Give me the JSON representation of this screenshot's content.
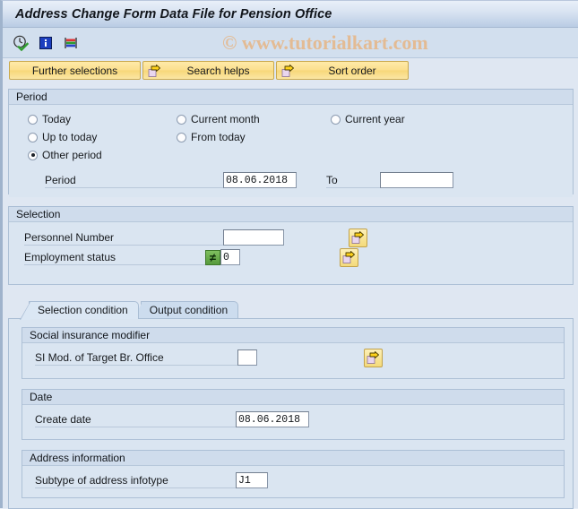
{
  "window": {
    "title": "Address Change Form Data File for Pension Office"
  },
  "toolbar": {
    "icons": [
      {
        "name": "execute-clock-icon",
        "glyph": "clock-check"
      },
      {
        "name": "info-icon",
        "glyph": "info"
      },
      {
        "name": "variant-icon",
        "glyph": "variant"
      }
    ],
    "watermark": "© www.tutorialkart.com"
  },
  "action_buttons": [
    {
      "label": "Further selections",
      "icon": null
    },
    {
      "label": "Search helps",
      "icon": "arrow-right-icon"
    },
    {
      "label": "Sort order",
      "icon": "arrow-right-icon"
    }
  ],
  "period_section": {
    "title": "Period",
    "radios": [
      {
        "label": "Today",
        "checked": false
      },
      {
        "label": "Current month",
        "checked": false
      },
      {
        "label": "Current year",
        "checked": false
      },
      {
        "label": "Up to today",
        "checked": false
      },
      {
        "label": "From today",
        "checked": false
      },
      {
        "label": "Other period",
        "checked": true
      }
    ],
    "period_label": "Period",
    "period_value": "08.06.2018",
    "to_label": "To",
    "to_value": "",
    "to_placeholder": ""
  },
  "selection_section": {
    "title": "Selection",
    "personnel_number_label": "Personnel Number",
    "personnel_number_value": "",
    "employment_status_label": "Employment status",
    "employment_status_operator": "≠",
    "employment_status_value": "0",
    "multi_select_tooltip": "Multiple selection"
  },
  "tabs": [
    {
      "label": "Selection condition",
      "active": true
    },
    {
      "label": "Output condition",
      "active": false
    }
  ],
  "si_section": {
    "title": "Social insurance modifier",
    "si_mod_label": "SI Mod. of Target Br. Office",
    "si_mod_value": ""
  },
  "date_section": {
    "title": "Date",
    "create_date_label": "Create date",
    "create_date_value": "08.06.2018"
  },
  "address_section": {
    "title": "Address information",
    "subtype_label": "Subtype of address infotype",
    "subtype_value": "J1"
  },
  "colors": {
    "title_bar_top": "#e9f0f9",
    "title_bar_bottom": "#b9cce4",
    "button_yellow": "#f7d779",
    "panel_blue": "#dae5f1",
    "watermark_orange": "#e6b585",
    "green_operator": "#569a3c"
  }
}
